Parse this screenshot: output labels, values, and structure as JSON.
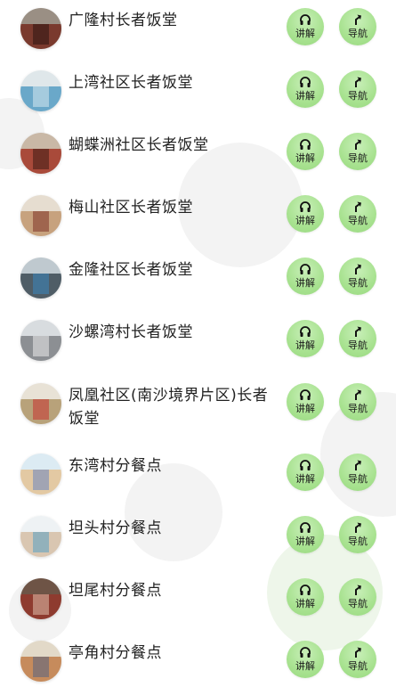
{
  "buttons": {
    "speak_label": "讲解",
    "nav_label": "导航"
  },
  "icons": {
    "speak": "headphones-icon",
    "nav": "turn-arrow-icon"
  },
  "colors": {
    "button_green": "#a8e290"
  },
  "places": [
    {
      "name": "广隆村长者饭堂"
    },
    {
      "name": "上湾社区长者饭堂"
    },
    {
      "name": "蝴蝶洲社区长者饭堂"
    },
    {
      "name": "梅山社区长者饭堂"
    },
    {
      "name": "金隆社区长者饭堂"
    },
    {
      "name": "沙螺湾村长者饭堂"
    },
    {
      "name": "凤凰社区(南沙境界片区)长者饭堂"
    },
    {
      "name": "东湾村分餐点"
    },
    {
      "name": "坦头村分餐点"
    },
    {
      "name": "坦尾村分餐点"
    },
    {
      "name": "亭角村分餐点"
    }
  ]
}
